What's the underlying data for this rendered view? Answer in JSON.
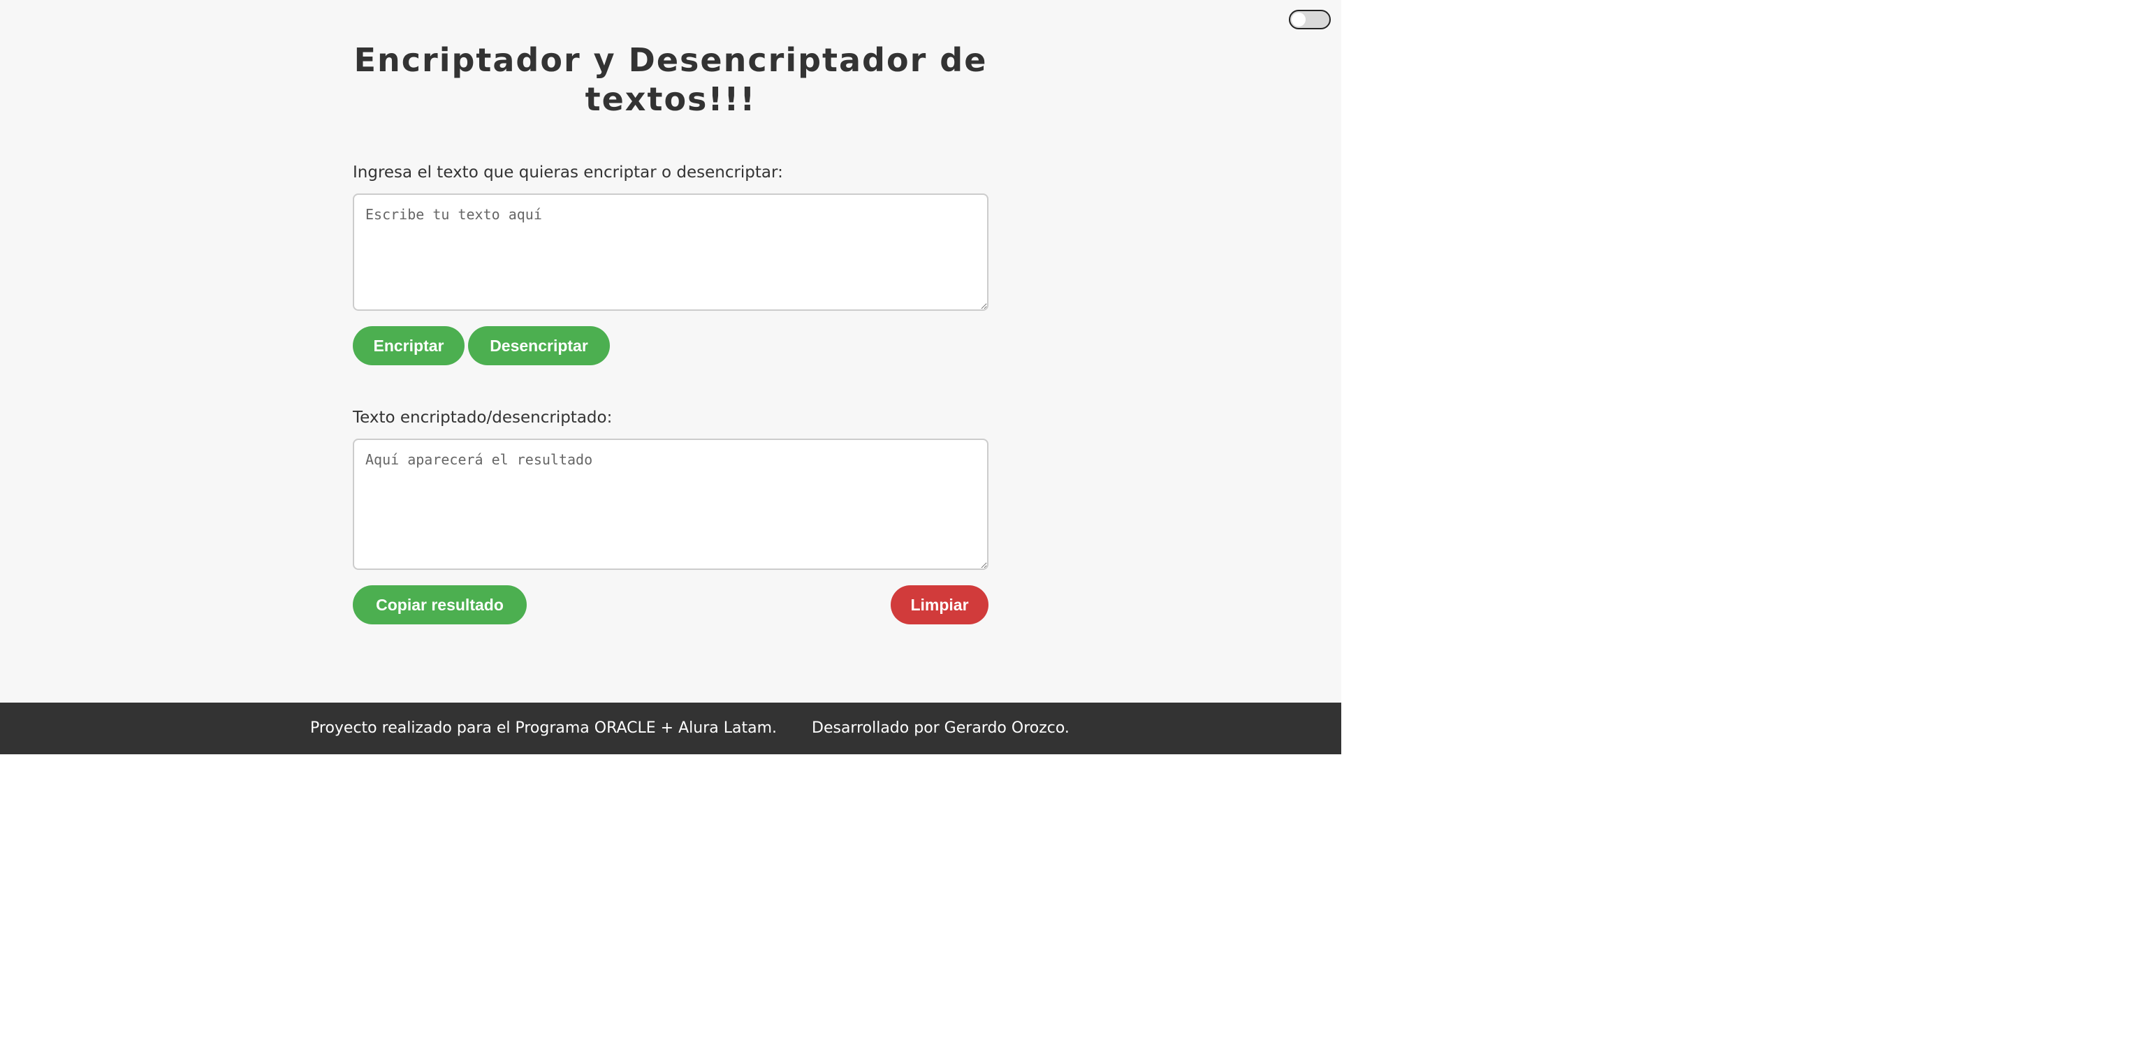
{
  "theme_toggle": {
    "state": "off"
  },
  "header": {
    "title": "Encriptador y Desencriptador de textos!!!"
  },
  "input_section": {
    "label": "Ingresa el texto que quieras encriptar o desencriptar:",
    "placeholder": "Escribe tu texto aquí",
    "value": ""
  },
  "actions": {
    "encrypt_label": "Encriptar",
    "decrypt_label": "Desencriptar"
  },
  "output_section": {
    "label": "Texto encriptado/desencriptado:",
    "placeholder": "Aquí aparecerá el resultado",
    "value": ""
  },
  "output_actions": {
    "copy_label": "Copiar resultado",
    "clear_label": "Limpiar"
  },
  "footer": {
    "project_text": "Proyecto realizado para el Programa ORACLE + Alura Latam.",
    "author_text": "Desarrollado por Gerardo Orozco."
  },
  "colors": {
    "primary_button": "#4caf50",
    "danger_button": "#d13b3b",
    "footer_background": "#333333",
    "page_background": "#f7f7f7"
  }
}
